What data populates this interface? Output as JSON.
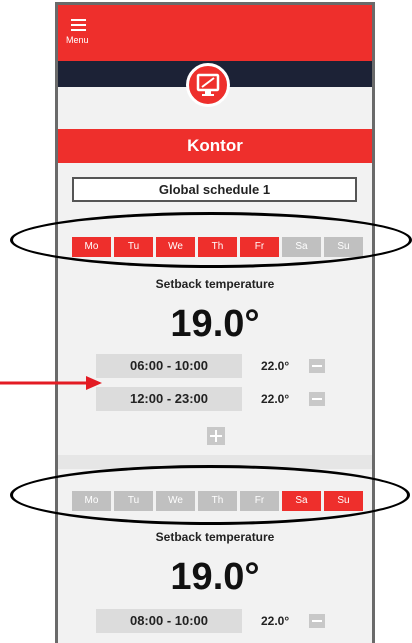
{
  "header": {
    "menu_label": "Menu",
    "room_icon": "monitor-icon"
  },
  "room": {
    "title": "Kontor"
  },
  "schedule": {
    "name": "Global schedule 1"
  },
  "blocks": [
    {
      "days": [
        {
          "label": "Mo",
          "active": true
        },
        {
          "label": "Tu",
          "active": true
        },
        {
          "label": "We",
          "active": true
        },
        {
          "label": "Th",
          "active": true
        },
        {
          "label": "Fr",
          "active": true
        },
        {
          "label": "Sa",
          "active": false
        },
        {
          "label": "Su",
          "active": false
        }
      ],
      "setback_label": "Setback temperature",
      "setback_value": "19.0°",
      "periods": [
        {
          "time": "06:00 - 10:00",
          "temp": "22.0°"
        },
        {
          "time": "12:00 - 23:00",
          "temp": "22.0°"
        }
      ]
    },
    {
      "days": [
        {
          "label": "Mo",
          "active": false
        },
        {
          "label": "Tu",
          "active": false
        },
        {
          "label": "We",
          "active": false
        },
        {
          "label": "Th",
          "active": false
        },
        {
          "label": "Fr",
          "active": false
        },
        {
          "label": "Sa",
          "active": true
        },
        {
          "label": "Su",
          "active": true
        }
      ],
      "setback_label": "Setback temperature",
      "setback_value": "19.0°",
      "periods": [
        {
          "time": "08:00 - 10:00",
          "temp": "22.0°"
        }
      ]
    }
  ],
  "colors": {
    "accent": "#ee2f2c",
    "dark": "#1c2236",
    "inactive": "#c0c0c0",
    "annotation_arrow": "#e31b23"
  }
}
